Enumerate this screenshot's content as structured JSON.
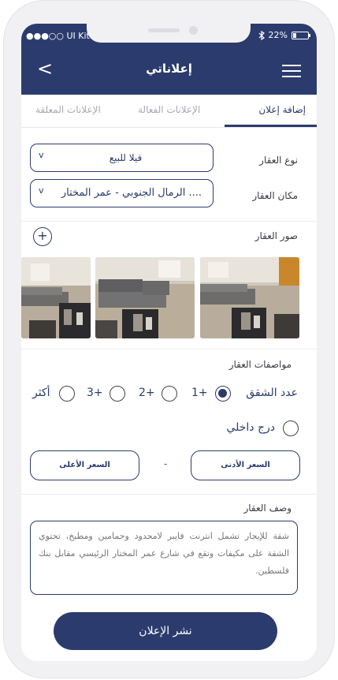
{
  "status_bar": {
    "carrier": "●●●○○ UI Kit",
    "battery": "22%",
    "battery_level": 0.22,
    "bluetooth_icon": "bluetooth-icon"
  },
  "app_bar": {
    "back_label": "<",
    "title": "إعلاناتي",
    "menu_icon": "hamburger-menu-icon"
  },
  "tabs": [
    {
      "label": "إضافة إعلان",
      "active": true
    },
    {
      "label": "الإعلانات الفعالة",
      "active": false
    },
    {
      "label": "الإعلانات المعلقة",
      "active": false
    }
  ],
  "form": {
    "property_type": {
      "label": "نوع العقار",
      "value": "فيلا للبيع",
      "caret": "v"
    },
    "location": {
      "label": "مكان العقار",
      "value": "الرمال الجنوبي - عمر المختار ....",
      "caret": "v"
    },
    "photos": {
      "label": "صور العقار",
      "add_label": "+",
      "count": 3
    },
    "specs": {
      "title": "مواصفات العقار",
      "rooms_label": "عدد الشقق",
      "options": [
        {
          "label": "1+",
          "checked": true
        },
        {
          "label": "2+",
          "checked": false
        },
        {
          "label": "3+",
          "checked": false
        },
        {
          "label": "أكثر",
          "checked": false
        }
      ],
      "inner_stairs": {
        "label": "درج داخلي",
        "checked": false
      }
    },
    "price": {
      "min_label": "السعر الأدنى",
      "max_label": "السعر الأعلى",
      "separator": "-"
    },
    "description": {
      "label": "وصف العقار",
      "text": "شقة للإيجار تشمل انترنت فايبر لامحدود وحمامين ومطبخ، تحتوي الشقة على مكيفات وتقع في شارع عمر المختار الرئيسي مقابل بنك فلسطين."
    },
    "publish_label": "نشر الإعلان"
  },
  "colors": {
    "primary": "#2b3b6d",
    "frame": "#f1f1f4",
    "muted_text": "#a9a9b2"
  }
}
